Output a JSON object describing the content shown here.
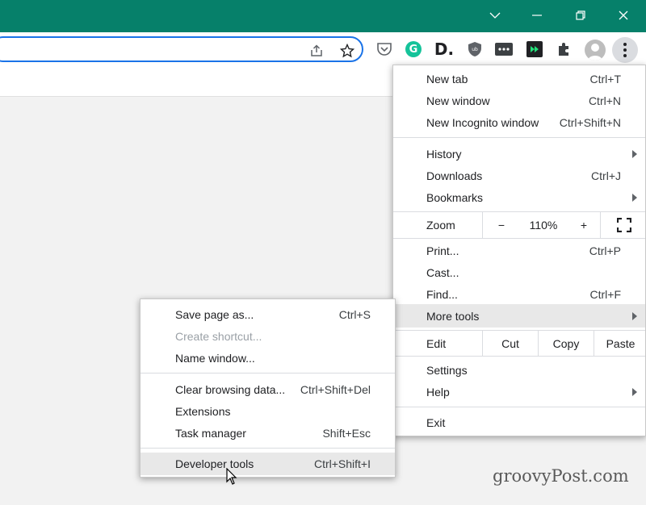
{
  "main_menu": {
    "new_tab": {
      "label": "New tab",
      "shortcut": "Ctrl+T"
    },
    "new_window": {
      "label": "New window",
      "shortcut": "Ctrl+N"
    },
    "new_incognito": {
      "label": "New Incognito window",
      "shortcut": "Ctrl+Shift+N"
    },
    "history": {
      "label": "History"
    },
    "downloads": {
      "label": "Downloads",
      "shortcut": "Ctrl+J"
    },
    "bookmarks": {
      "label": "Bookmarks"
    },
    "zoom": {
      "label": "Zoom",
      "minus": "−",
      "value": "110%",
      "plus": "+"
    },
    "print": {
      "label": "Print...",
      "shortcut": "Ctrl+P"
    },
    "cast": {
      "label": "Cast..."
    },
    "find": {
      "label": "Find...",
      "shortcut": "Ctrl+F"
    },
    "more_tools": {
      "label": "More tools"
    },
    "edit": {
      "label": "Edit",
      "cut": "Cut",
      "copy": "Copy",
      "paste": "Paste"
    },
    "settings": {
      "label": "Settings"
    },
    "help": {
      "label": "Help"
    },
    "exit": {
      "label": "Exit"
    }
  },
  "sub_menu": {
    "save_page": {
      "label": "Save page as...",
      "shortcut": "Ctrl+S"
    },
    "create_shortcut": {
      "label": "Create shortcut..."
    },
    "name_window": {
      "label": "Name window..."
    },
    "clear_data": {
      "label": "Clear browsing data...",
      "shortcut": "Ctrl+Shift+Del"
    },
    "extensions": {
      "label": "Extensions"
    },
    "task_manager": {
      "label": "Task manager",
      "shortcut": "Shift+Esc"
    },
    "developer_tools": {
      "label": "Developer tools",
      "shortcut": "Ctrl+Shift+I"
    }
  },
  "extensions": {
    "grammarly": "G",
    "d_ext": "D."
  },
  "watermark": "groovyPost.com",
  "colors": {
    "titlebar": "#06806a",
    "omnibox_border": "#1a73e8",
    "highlight": "#e8e8e8"
  }
}
